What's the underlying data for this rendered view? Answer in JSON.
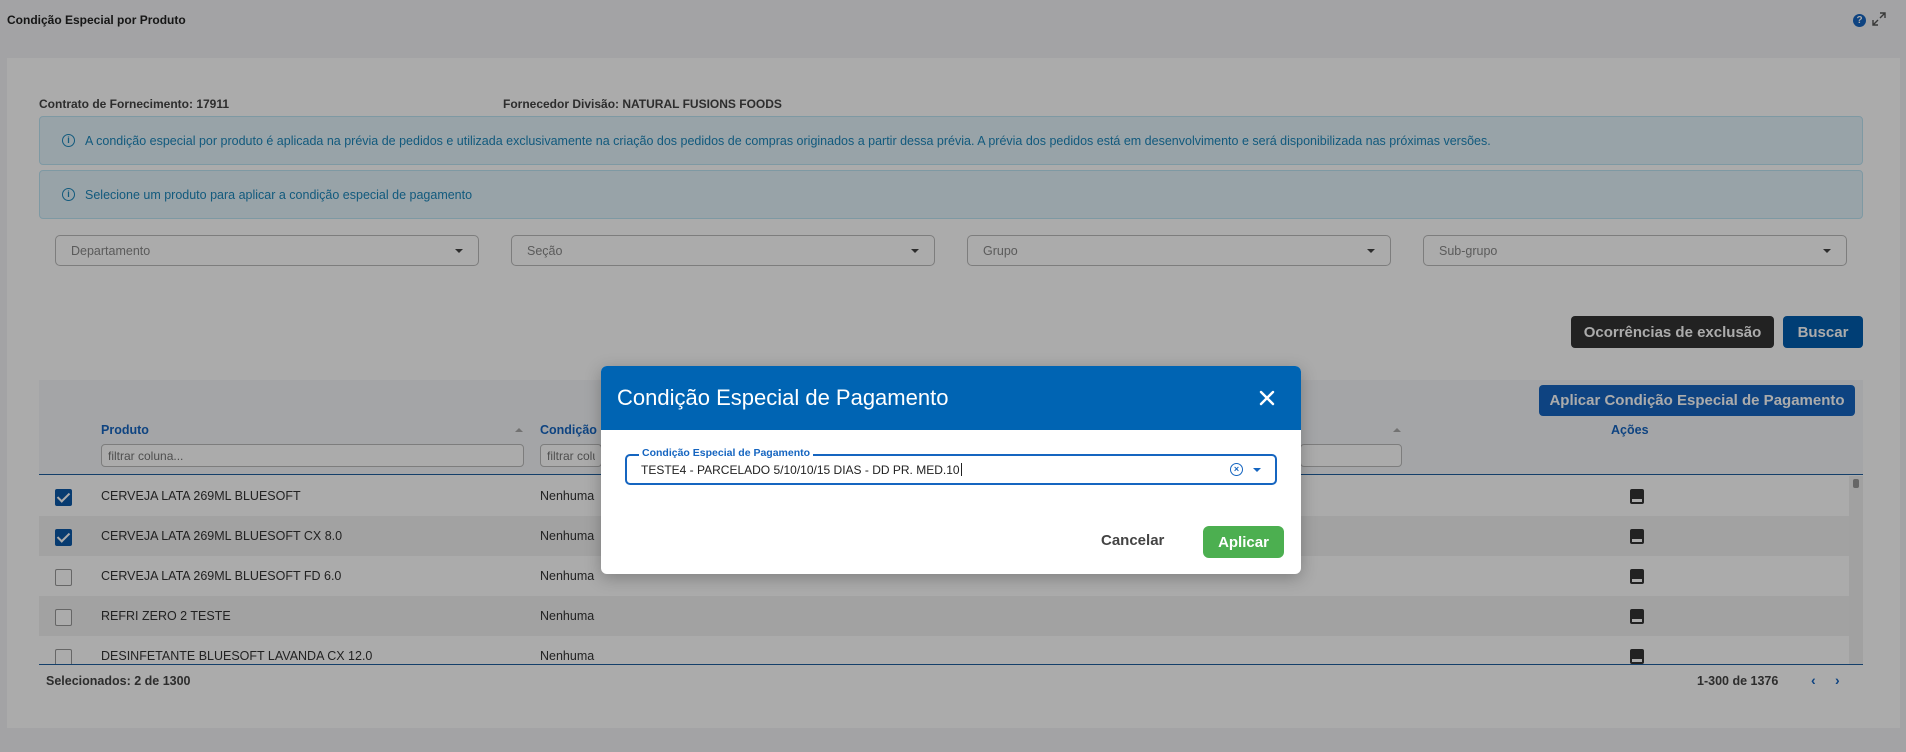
{
  "page": {
    "title": "Condição Especial por Produto"
  },
  "meta": {
    "contract": "Contrato de Fornecimento: 17911",
    "supplier": "Fornecedor Divisão: NATURAL FUSIONS FOODS"
  },
  "info": {
    "message1": "A condição especial por produto é aplicada na prévia de pedidos e utilizada exclusivamente na criação dos pedidos de compras originados a partir dessa prévia. A prévia dos pedidos está em desenvolvimento e será disponibilizada nas próximas versões.",
    "message2": "Selecione um produto para aplicar a condição especial de pagamento"
  },
  "filters": [
    {
      "placeholder": "Departamento"
    },
    {
      "placeholder": "Seção"
    },
    {
      "placeholder": "Grupo"
    },
    {
      "placeholder": "Sub-grupo"
    }
  ],
  "actions": {
    "exclusions": "Ocorrências de exclusão",
    "search": "Buscar",
    "apply_condition": "Aplicar Condição Especial de Pagamento"
  },
  "table": {
    "columns": [
      "Produto",
      "Condição",
      "Ações"
    ],
    "filter_placeholder": "filtrar coluna...",
    "filter_placeholder_short": "filtrar colu",
    "rows": [
      {
        "product": "CERVEJA LATA 269ML BLUESOFT",
        "condition": "Nenhuma",
        "checked": true
      },
      {
        "product": "CERVEJA LATA 269ML BLUESOFT CX 8.0",
        "condition": "Nenhuma",
        "checked": true
      },
      {
        "product": "CERVEJA LATA 269ML BLUESOFT FD 6.0",
        "condition": "Nenhuma",
        "checked": false
      },
      {
        "product": "REFRI ZERO 2 TESTE",
        "condition": "Nenhuma",
        "checked": false
      },
      {
        "product": "DESINFETANTE BLUESOFT LAVANDA CX 12.0",
        "condition": "Nenhuma",
        "checked": false
      }
    ],
    "selected": "Selecionados: 2 de 1300",
    "pagination": "1-300 de 1376"
  },
  "modal": {
    "title": "Condição Especial de Pagamento",
    "field_label": "Condição Especial de Pagamento",
    "field_value": "TESTE4 - PARCELADO 5/10/10/15 DIAS - DD PR. MED.10",
    "cancel": "Cancelar",
    "apply": "Aplicar"
  }
}
